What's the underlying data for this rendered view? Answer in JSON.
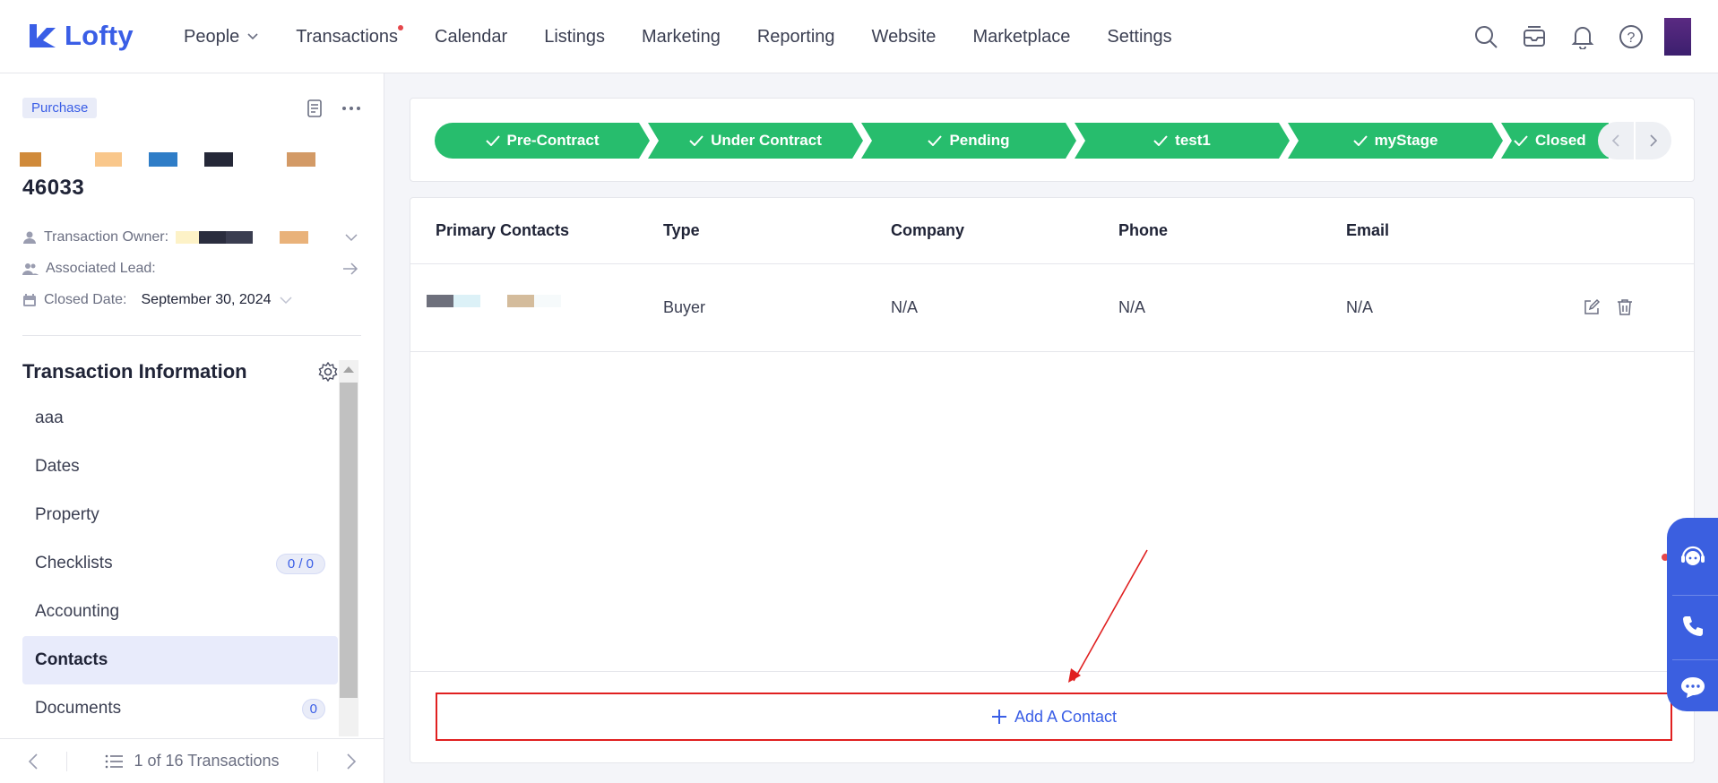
{
  "app": {
    "brand": "Lofty"
  },
  "nav": {
    "items": [
      {
        "label": "People",
        "has_dropdown": true
      },
      {
        "label": "Transactions",
        "has_dot": true
      },
      {
        "label": "Calendar"
      },
      {
        "label": "Listings"
      },
      {
        "label": "Marketing"
      },
      {
        "label": "Reporting"
      },
      {
        "label": "Website"
      },
      {
        "label": "Marketplace"
      },
      {
        "label": "Settings"
      }
    ],
    "icons": [
      "search-icon",
      "inbox-icon",
      "bell-icon",
      "help-icon"
    ]
  },
  "transaction": {
    "type_tag": "Purchase",
    "id": "46033",
    "owner_label": "Transaction Owner:",
    "lead_label": "Associated Lead:",
    "closed_label": "Closed Date:",
    "closed_value": "September 30, 2024"
  },
  "info": {
    "title": "Transaction Information",
    "items": [
      {
        "label": "aaa"
      },
      {
        "label": "Dates"
      },
      {
        "label": "Property"
      },
      {
        "label": "Checklists",
        "badge": "0 / 0"
      },
      {
        "label": "Accounting"
      },
      {
        "label": "Contacts",
        "active": true
      },
      {
        "label": "Documents",
        "badge": "0"
      }
    ]
  },
  "pager": {
    "text": "1 of 16 Transactions"
  },
  "stages": [
    {
      "label": "Pre-Contract"
    },
    {
      "label": "Under Contract"
    },
    {
      "label": "Pending"
    },
    {
      "label": "test1"
    },
    {
      "label": "myStage"
    },
    {
      "label": "Closed"
    }
  ],
  "colors": {
    "stage_done": "#27bd6d",
    "accent": "#3a5ee6",
    "annotation": "#e02020"
  },
  "contacts": {
    "headers": [
      "Primary Contacts",
      "Type",
      "Company",
      "Phone",
      "Email"
    ],
    "rows": [
      {
        "type": "Buyer",
        "company": "N/A",
        "phone": "N/A",
        "email": "N/A"
      }
    ],
    "add_label": "Add A Contact"
  }
}
